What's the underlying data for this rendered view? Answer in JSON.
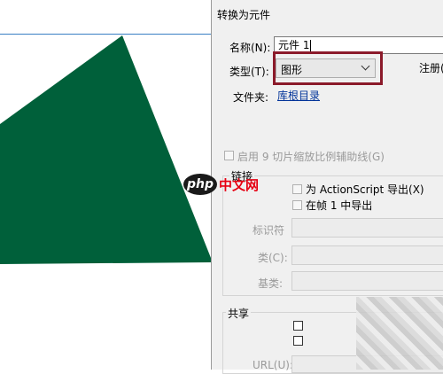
{
  "dialog": {
    "title": "转换为元件",
    "name_label": "名称(N):",
    "name_value": "元件 1",
    "type_label": "类型(T):",
    "type_value": "图形",
    "register_label": "注册(R)",
    "folder_label": "文件夹:",
    "folder_value": "库根目录",
    "nine_slice_label": "启用 9 切片缩放比例辅助线(G)",
    "linkage_header": "链接",
    "export_as_label": "为 ActionScript 导出(X)",
    "export_frame1_label": "在帧 1 中导出",
    "identifier_label": "标识符",
    "class_label": "类(C):",
    "base_class_label": "基类:",
    "sharing_header": "共享",
    "url_label": "URL(U):"
  },
  "stage": {
    "shape_color": "#00603a",
    "guide_color": "#3a7fc4"
  },
  "watermark": {
    "logo": "php",
    "text": "中文网"
  },
  "colors": {
    "highlight": "#8b1a2a",
    "link": "#003399"
  }
}
